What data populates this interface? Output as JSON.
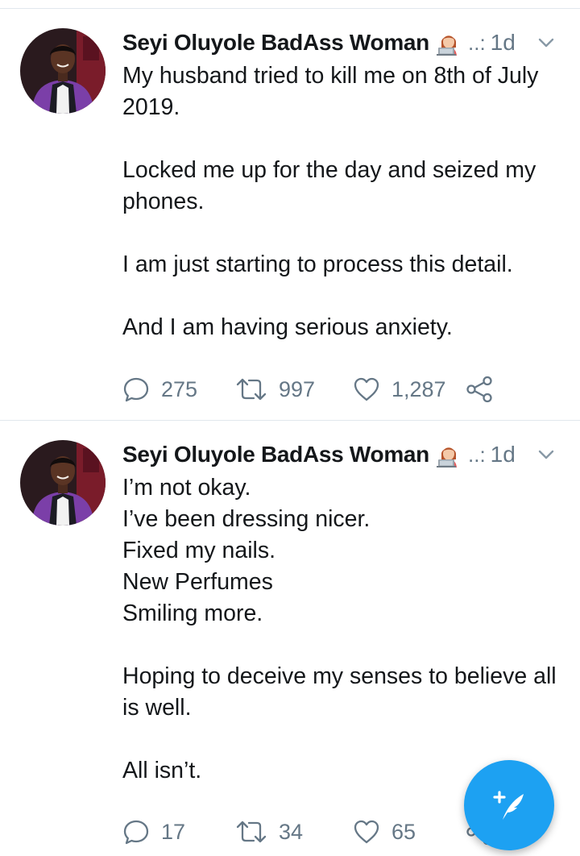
{
  "tweets": [
    {
      "author_name": "Seyi Oluyole BadAss Woman",
      "author_emoji": "woman-technologist-icon",
      "handle_ellipsis": "..:",
      "time": "1d",
      "text": "My husband tried to kill me on 8th of July 2019.\n\nLocked me up for the day and seized my phones.\n\nI am just starting to process this detail.\n\nAnd I am having serious anxiety.",
      "replies": "275",
      "retweets": "997",
      "likes": "1,287"
    },
    {
      "author_name": "Seyi Oluyole BadAss Woman",
      "author_emoji": "woman-technologist-icon",
      "handle_ellipsis": "..:",
      "time": "1d",
      "text": "I’m not okay.\nI’ve been dressing nicer.\nFixed my nails.\nNew Perfumes\nSmiling more.\n\nHoping to deceive my senses to believe all is well.\n\nAll isn’t.",
      "replies": "17",
      "retweets": "34",
      "likes": "65"
    }
  ],
  "colors": {
    "text": "#14171a",
    "muted": "#657786",
    "divider": "#e1e8ed",
    "accent": "#1da1f2"
  },
  "compose_button": {
    "icon": "compose-feather-icon"
  }
}
